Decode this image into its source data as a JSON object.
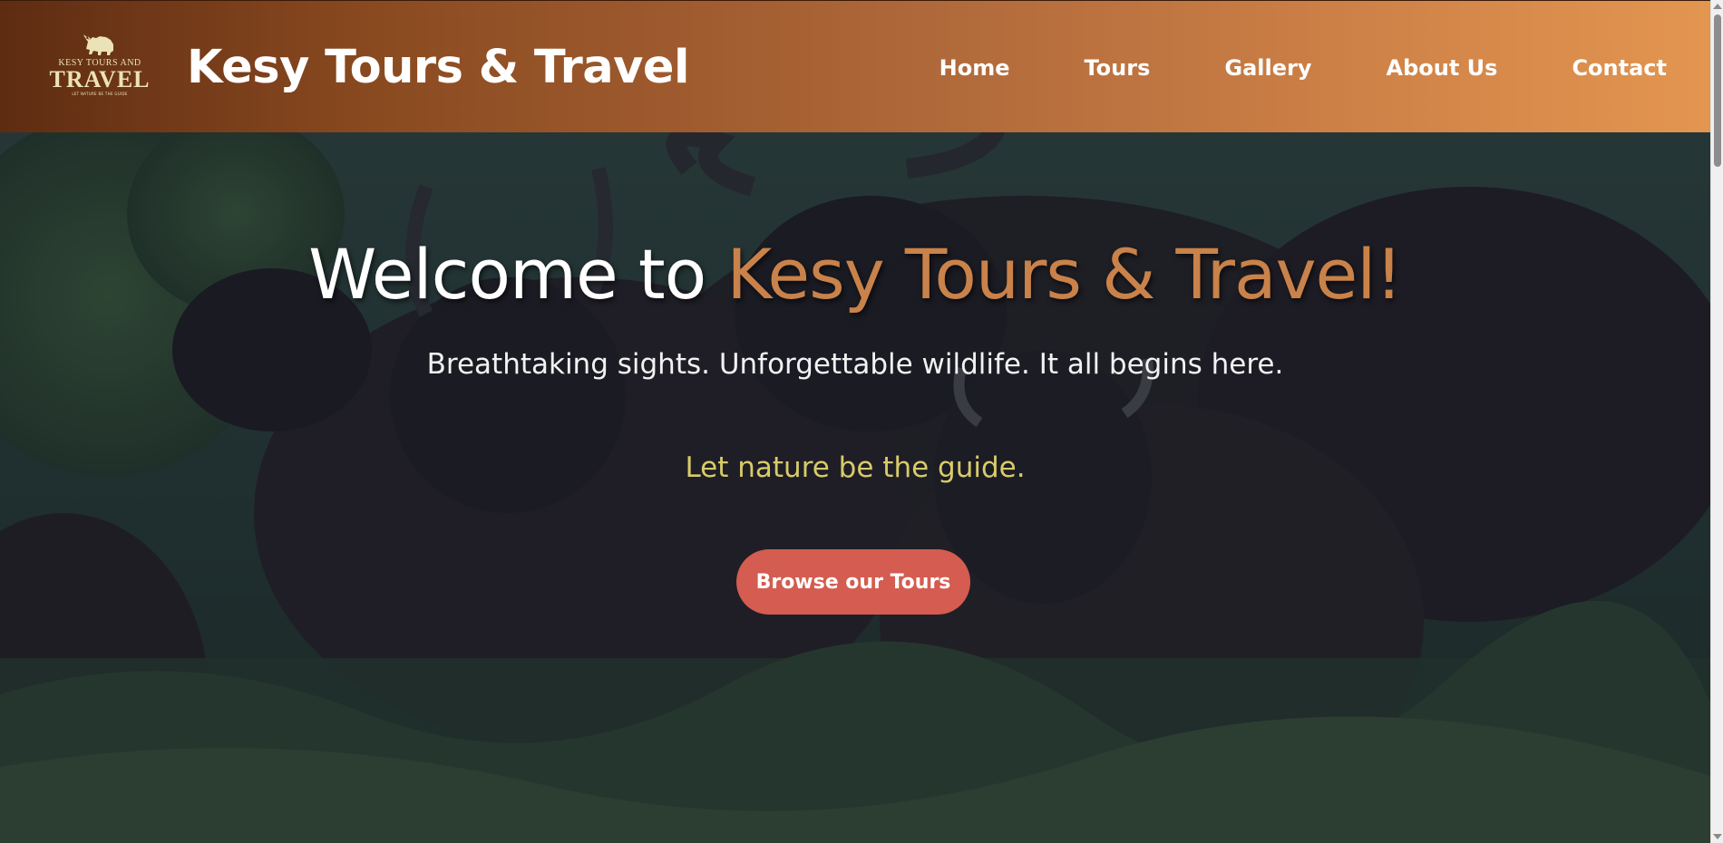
{
  "header": {
    "logo": {
      "line1": "KESY TOURS AND",
      "line2": "TRAVEL",
      "line3": "LET NATURE BE THE GUIDE"
    },
    "brand_title": "Kesy Tours & Travel",
    "nav": [
      {
        "label": "Home"
      },
      {
        "label": "Tours"
      },
      {
        "label": "Gallery"
      },
      {
        "label": "About Us"
      },
      {
        "label": "Contact"
      }
    ]
  },
  "hero": {
    "title_prefix": "Welcome to ",
    "title_accent": "Kesy Tours & Travel!",
    "subtitle": "Breathtaking sights. Unforgettable wildlife. It all begins here.",
    "tagline": "Let nature be the guide.",
    "cta_label": "Browse our Tours"
  },
  "colors": {
    "header_gradient_start": "#5e2c12",
    "header_gradient_end": "#e39650",
    "title_accent": "#c9824a",
    "tagline": "#d8cb6a",
    "cta_background": "#d45c50"
  }
}
